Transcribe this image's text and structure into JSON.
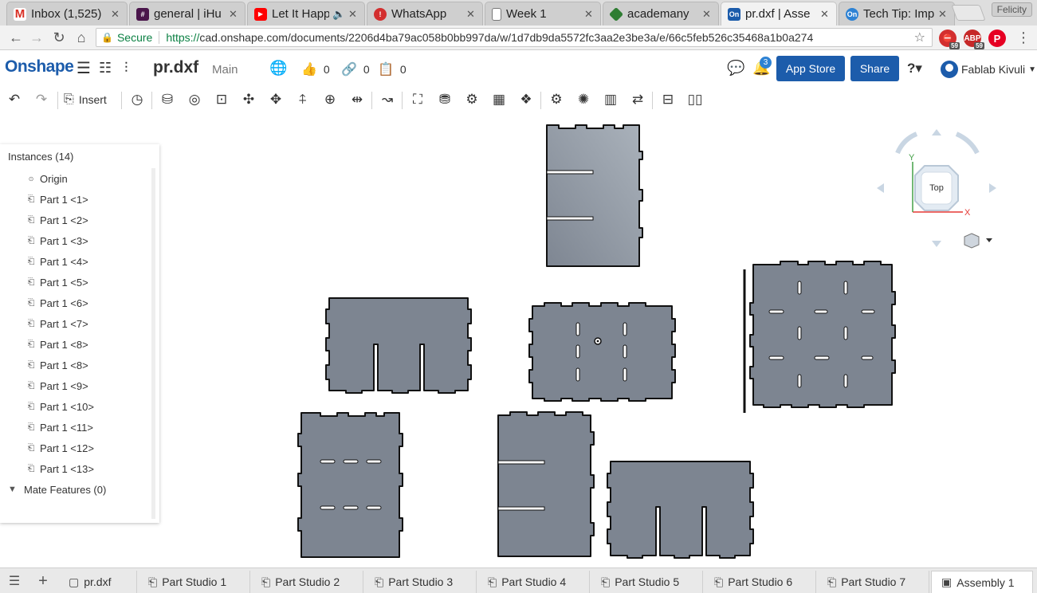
{
  "browser": {
    "tabs": [
      {
        "title": "Inbox (1,525)",
        "icon": "gmail-icon",
        "color": "#d93025",
        "glyph": "M"
      },
      {
        "title": "general | iHu",
        "icon": "slack-icon",
        "color": "#4a154b",
        "glyph": "#"
      },
      {
        "title": "Let It Happ",
        "icon": "youtube-icon",
        "color": "#ff0000",
        "glyph": "▶"
      },
      {
        "title": "WhatsApp",
        "icon": "whatsapp-icon",
        "color": "#d32f2f",
        "glyph": "!"
      },
      {
        "title": "Week 1",
        "icon": "document-icon",
        "color": "#ffffff",
        "glyph": "▯"
      },
      {
        "title": "academany",
        "icon": "academany-icon",
        "color": "#2e7d32",
        "glyph": "◆"
      },
      {
        "title": "pr.dxf | Asse",
        "icon": "onshape-icon",
        "color": "#1c5cab",
        "glyph": "On"
      },
      {
        "title": "Tech Tip: Imp",
        "icon": "onshape-tip-icon",
        "color": "#2d82d4",
        "glyph": "On"
      }
    ],
    "profile_name": "Felicity",
    "secure_label": "Secure",
    "url_scheme": "https://",
    "url_rest": "cad.onshape.com/documents/2206d4ba79ac058b0bb997da/w/1d7db9da5572fc3aa2e3be3a/e/66c5feb526c35468a1b0a274",
    "extensions": [
      {
        "name": "adblock-extension-icon",
        "color": "#d32f2f",
        "badge": "59"
      },
      {
        "name": "abp-extension-icon",
        "color": "#c62828",
        "badge": "59"
      },
      {
        "name": "pinterest-extension-icon",
        "color": "#e60023",
        "badge": ""
      }
    ]
  },
  "app": {
    "logo": "Onshape",
    "doc_name": "pr.dxf",
    "branch": "Main",
    "likes": "0",
    "links": "0",
    "copies": "0",
    "notifications": "3",
    "app_store_label": "App Store",
    "share_label": "Share",
    "user_name": "Fablab Kivuli",
    "insert_label": "Insert"
  },
  "instances": {
    "title": "Instances (14)",
    "origin": "Origin",
    "items": [
      "Part 1 <1>",
      "Part 1 <2>",
      "Part 1 <3>",
      "Part 1 <4>",
      "Part 1 <5>",
      "Part 1 <6>",
      "Part 1 <7>",
      "Part 1 <8>",
      "Part 1 <8>",
      "Part 1 <9>",
      "Part 1 <10>",
      "Part 1 <11>",
      "Part 1 <12>",
      "Part 1 <13>"
    ],
    "mate_features": "Mate Features (0)"
  },
  "view_cube": {
    "face_label": "Top",
    "axis_x": "X",
    "axis_y": "Y"
  },
  "element_tabs": [
    {
      "label": "pr.dxf",
      "icon": "drawing-tab-icon"
    },
    {
      "label": "Part Studio 1",
      "icon": "part-studio-icon"
    },
    {
      "label": "Part Studio 2",
      "icon": "part-studio-icon"
    },
    {
      "label": "Part Studio 3",
      "icon": "part-studio-icon"
    },
    {
      "label": "Part Studio 4",
      "icon": "part-studio-icon"
    },
    {
      "label": "Part Studio 5",
      "icon": "part-studio-icon"
    },
    {
      "label": "Part Studio 6",
      "icon": "part-studio-icon"
    },
    {
      "label": "Part Studio 7",
      "icon": "part-studio-icon"
    },
    {
      "label": "Assembly 1",
      "icon": "assembly-icon",
      "active": true
    }
  ],
  "colors": {
    "brand": "#1c5cab",
    "part_fill": "#7d8591",
    "part_stroke": "#111111"
  }
}
